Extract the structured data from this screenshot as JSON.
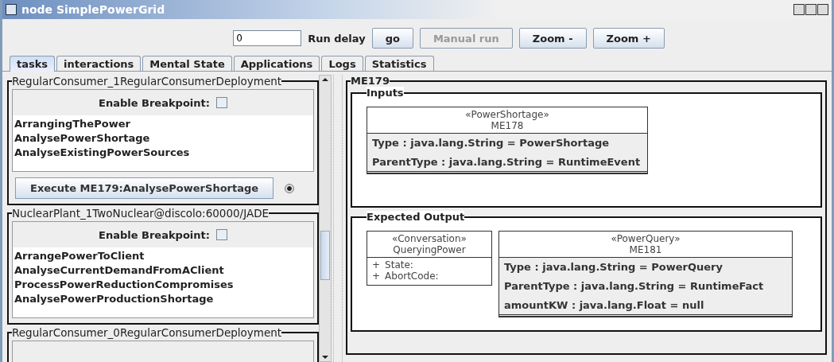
{
  "window": {
    "title": "node SimplePowerGrid"
  },
  "toolbar": {
    "delay_value": "0",
    "delay_label": "Run delay",
    "buttons": [
      {
        "label": "go",
        "disabled": false
      },
      {
        "label": "Manual run",
        "disabled": true
      },
      {
        "label": "Zoom -",
        "disabled": false
      },
      {
        "label": "Zoom +",
        "disabled": false
      }
    ]
  },
  "tabs": [
    {
      "label": "tasks",
      "selected": true
    },
    {
      "label": "interactions",
      "selected": false
    },
    {
      "label": "Mental State",
      "selected": false
    },
    {
      "label": "Applications",
      "selected": false
    },
    {
      "label": "Logs",
      "selected": false
    },
    {
      "label": "Statistics",
      "selected": false
    }
  ],
  "agents": [
    {
      "title": "RegularConsumer_1RegularConsumerDeployment",
      "breakpoint_label": "Enable Breakpoint:",
      "breakpoint_checked": false,
      "tasks": [
        "ArrangingThePower",
        "AnalysePowerShortage",
        "AnalyseExistingPowerSources"
      ],
      "execute_button": "Execute ME179:AnalysePowerShortage",
      "radio_selected": true
    },
    {
      "title": "NuclearPlant_1TwoNuclear@discolo:60000/JADE",
      "breakpoint_label": "Enable Breakpoint:",
      "breakpoint_checked": false,
      "tasks": [
        "ArrangePowerToClient",
        "AnalyseCurrentDemandFromAClient",
        "ProcessPowerReductionCompromises",
        "AnalysePowerProductionShortage"
      ]
    },
    {
      "title": "RegularConsumer_0RegularConsumerDeployment"
    }
  ],
  "event": {
    "title": "ME179",
    "sections": [
      {
        "title": "Inputs",
        "classes": [
          {
            "kind": "fact",
            "stereotype": "«PowerShortage»",
            "name": "ME178",
            "attributes": [
              "Type : java.lang.String = PowerShortage",
              "ParentType : java.lang.String = RuntimeEvent"
            ]
          }
        ]
      },
      {
        "title": "Expected Output",
        "classes": [
          {
            "kind": "conversation",
            "stereotype": "«Conversation»",
            "name": "QueryingPower",
            "attributes": [
              {
                "visibility": "+",
                "name": "State:"
              },
              {
                "visibility": "+",
                "name": "AbortCode:"
              }
            ]
          },
          {
            "kind": "fact",
            "stereotype": "«PowerQuery»",
            "name": "ME181",
            "attributes": [
              "Type : java.lang.String = PowerQuery",
              "ParentType : java.lang.String = RuntimeFact",
              "amountKW : java.lang.Float = null"
            ]
          }
        ]
      }
    ]
  }
}
